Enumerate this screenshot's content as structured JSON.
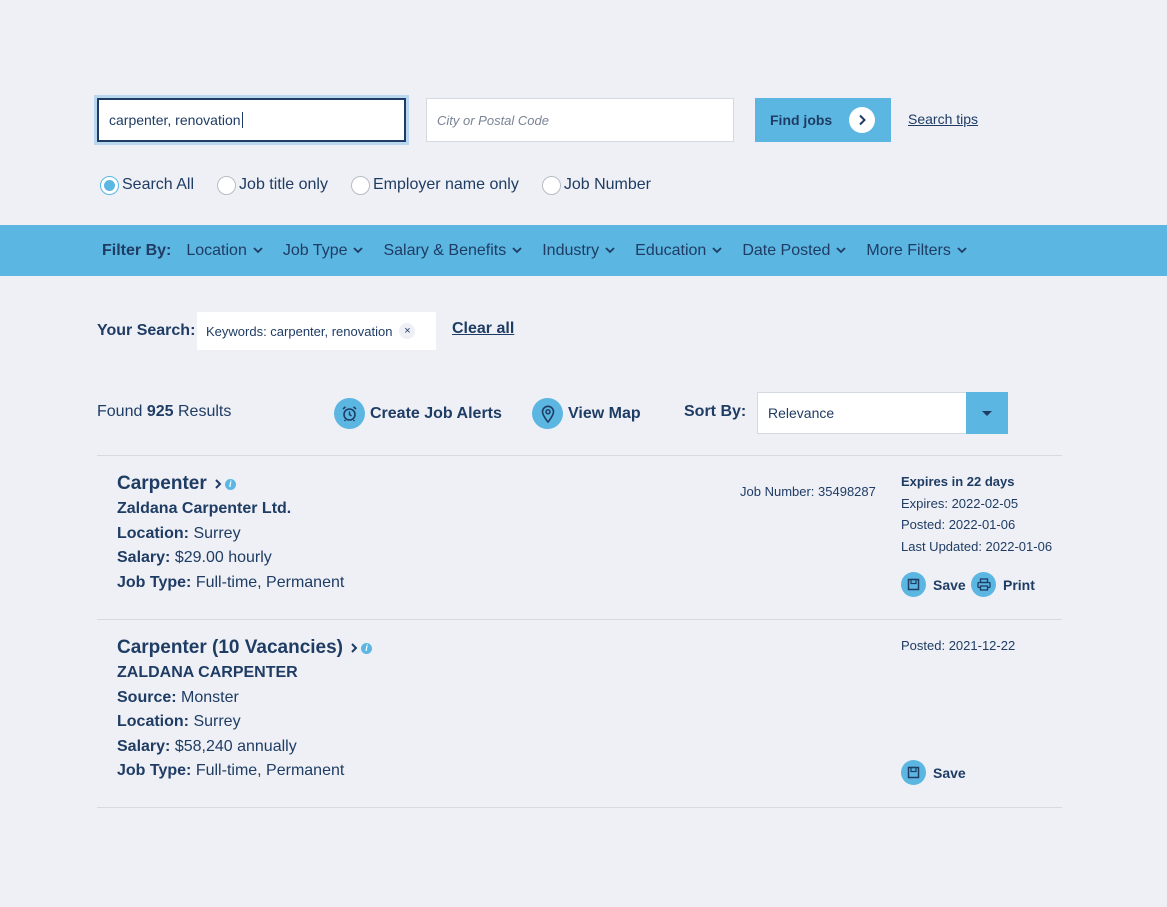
{
  "search": {
    "keywords_value": "carpenter, renovation",
    "location_placeholder": "City or Postal Code",
    "find_label": "Find jobs",
    "tips_label": "Search tips"
  },
  "search_scope": [
    {
      "label": "Search All",
      "checked": true
    },
    {
      "label": "Job title only",
      "checked": false
    },
    {
      "label": "Employer name only",
      "checked": false
    },
    {
      "label": "Job Number",
      "checked": false
    }
  ],
  "filters": {
    "label": "Filter By:",
    "items": [
      "Location",
      "Job Type",
      "Salary & Benefits",
      "Industry",
      "Education",
      "Date Posted",
      "More Filters"
    ]
  },
  "your_search": {
    "label": "Your Search:",
    "chip": "Keywords: carpenter, renovation",
    "chip_remove": "×",
    "clear_all": "Clear all"
  },
  "results": {
    "found_prefix": "Found",
    "count": "925",
    "found_suffix": "Results",
    "create_alerts": "Create Job Alerts",
    "view_map": "View Map",
    "sort_label": "Sort By:",
    "sort_value": "Relevance"
  },
  "jobs": [
    {
      "title": "Carpenter",
      "company": "Zaldana Carpenter Ltd.",
      "location_label": "Location:",
      "location": "Surrey",
      "salary_label": "Salary:",
      "salary": "$29.00 hourly",
      "type_label": "Job Type:",
      "type": "Full-time, Permanent",
      "job_number": "Job Number: 35498287",
      "expires_in": "Expires in 22 days",
      "expires": "Expires: 2022-02-05",
      "posted": "Posted: 2022-01-06",
      "updated": "Last Updated: 2022-01-06",
      "save": "Save",
      "print": "Print"
    },
    {
      "title": "Carpenter (10 Vacancies)",
      "company": "ZALDANA CARPENTER",
      "source_label": "Source:",
      "source": "Monster",
      "location_label": "Location:",
      "location": "Surrey",
      "salary_label": "Salary:",
      "salary": "$58,240 annually",
      "type_label": "Job Type:",
      "type": "Full-time, Permanent",
      "posted": "Posted: 2021-12-22",
      "save": "Save"
    }
  ],
  "colors": {
    "accent": "#5bb6e2",
    "text": "#1f3c64",
    "background": "#eef0f5"
  }
}
